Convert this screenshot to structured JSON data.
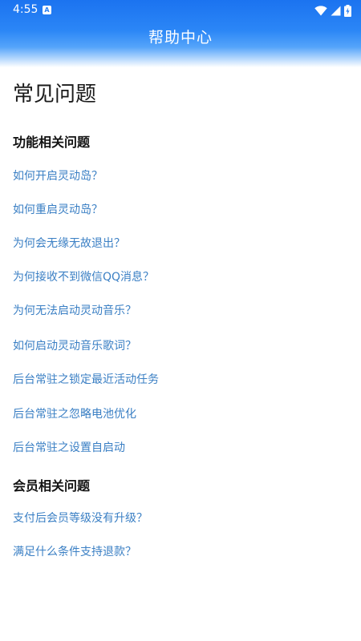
{
  "status_bar": {
    "time": "4:55",
    "notification_icon": "a-box-icon",
    "wifi_icon": "wifi-icon",
    "signal_icon": "cellular-signal-icon",
    "battery_icon": "battery-charging-icon"
  },
  "header": {
    "title": "帮助中心",
    "gradient_top": "#1b73f0",
    "gradient_bottom": "#ffffff"
  },
  "page": {
    "heading": "常见问题",
    "sections": [
      {
        "title": "功能相关问题",
        "items": [
          "如何开启灵动岛？",
          "如何重启灵动岛？",
          "为何会无缘无故退出？",
          "为何接收不到微信QQ消息？",
          "为何无法启动灵动音乐？",
          "如何启动灵动音乐歌词？",
          "后台常驻之锁定最近活动任务",
          "后台常驻之忽略电池优化",
          "后台常驻之设置自启动"
        ]
      },
      {
        "title": "会员相关问题",
        "items": [
          "支付后会员等级没有升级？",
          "满足什么条件支持退款？"
        ]
      }
    ]
  },
  "colors": {
    "link": "#3a7fc4",
    "heading": "#1a1a1a",
    "section_title": "#111111"
  }
}
